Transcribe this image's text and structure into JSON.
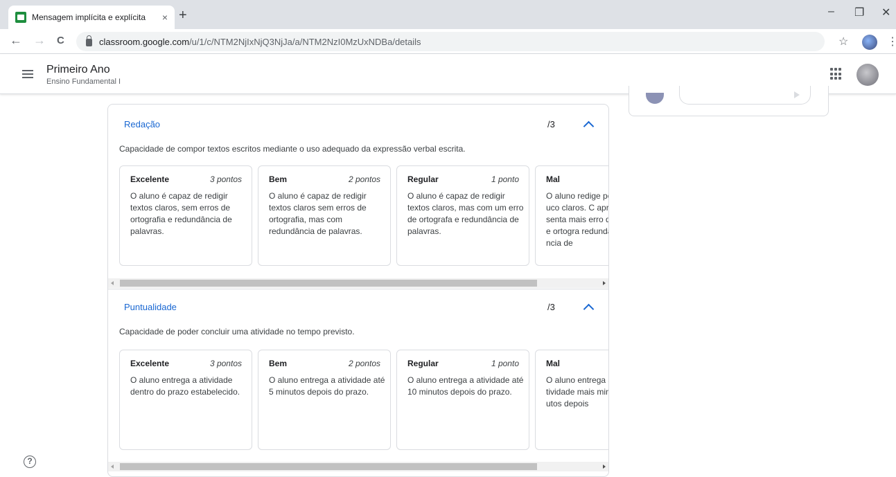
{
  "browser": {
    "tab_title": "Mensagem implícita e explícita",
    "tab_close": "×",
    "new_tab": "+",
    "url_host": "classroom.google.com",
    "url_path": "/u/1/c/NTM2NjIxNjQ3NjJa/a/NTM2NzI0MzUxNDBa/details",
    "back": "←",
    "forward": "→",
    "reload": "C",
    "star": "☆",
    "menu": "⋮",
    "minimize": "–",
    "restore": "❐",
    "close": "✕"
  },
  "header": {
    "class_name": "Primeiro Ano",
    "section": "Ensino Fundamental I"
  },
  "rubric": {
    "criteria": [
      {
        "title": "Redação",
        "score": "/3",
        "description": "Capacidade de compor textos escritos mediante o uso adequado da expressão verbal escrita.",
        "levels": [
          {
            "name": "Excelente",
            "points": "3 pontos",
            "description": "O aluno é capaz de redigir textos claros, sem erros de ortografia e redundância de palavras."
          },
          {
            "name": "Bem",
            "points": "2 pontos",
            "description": "O aluno é capaz de redigir textos claros sem erros de ortografia, mas com redundância de palavras."
          },
          {
            "name": "Regular",
            "points": "1 ponto",
            "description": "O aluno é capaz de redigir textos claros, mas com um erro de ortografa e redundância de palavras."
          },
          {
            "name": "Mal",
            "points": "",
            "description": "O aluno redige pouco claros. C apresenta mais erro de ortogra redundância de"
          }
        ]
      },
      {
        "title": "Puntualidade",
        "score": "/3",
        "description": "Capacidade de poder concluir uma atividade no tempo previsto.",
        "levels": [
          {
            "name": "Excelente",
            "points": "3 pontos",
            "description": "O aluno entrega a atividade dentro do prazo estabelecido."
          },
          {
            "name": "Bem",
            "points": "2 pontos",
            "description": "O aluno entrega a atividade até 5 minutos depois do prazo."
          },
          {
            "name": "Regular",
            "points": "1 ponto",
            "description": "O aluno entrega a atividade até 10 minutos depois do prazo."
          },
          {
            "name": "Mal",
            "points": "",
            "description": "O aluno entrega atividade mais minutos depois"
          }
        ]
      }
    ]
  },
  "help_icon": "?"
}
